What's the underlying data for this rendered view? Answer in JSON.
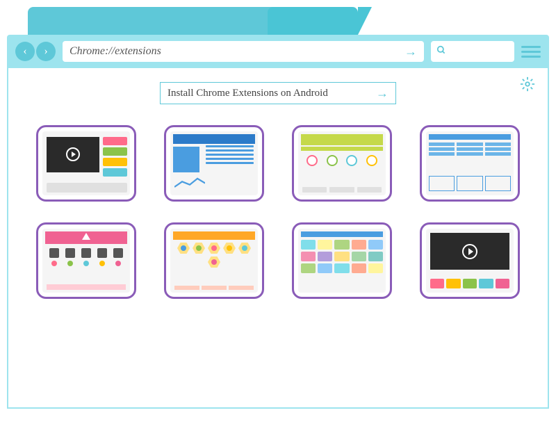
{
  "toolbar": {
    "url": "Chrome://extensions",
    "search_placeholder": ""
  },
  "prompt": {
    "text": "Install Chrome Extensions on Android"
  },
  "cards": [
    {
      "name": "video-player-extension"
    },
    {
      "name": "blue-layout-extension"
    },
    {
      "name": "green-circles-extension"
    },
    {
      "name": "blue-stats-extension"
    },
    {
      "name": "pink-shop-extension"
    },
    {
      "name": "hexagon-extension"
    },
    {
      "name": "color-grid-extension"
    },
    {
      "name": "dark-video-extension"
    }
  ],
  "colors": {
    "accent": "#5ec8d8",
    "toolbar_bg": "#9de4ee",
    "card_border": "#8a5cb8"
  }
}
